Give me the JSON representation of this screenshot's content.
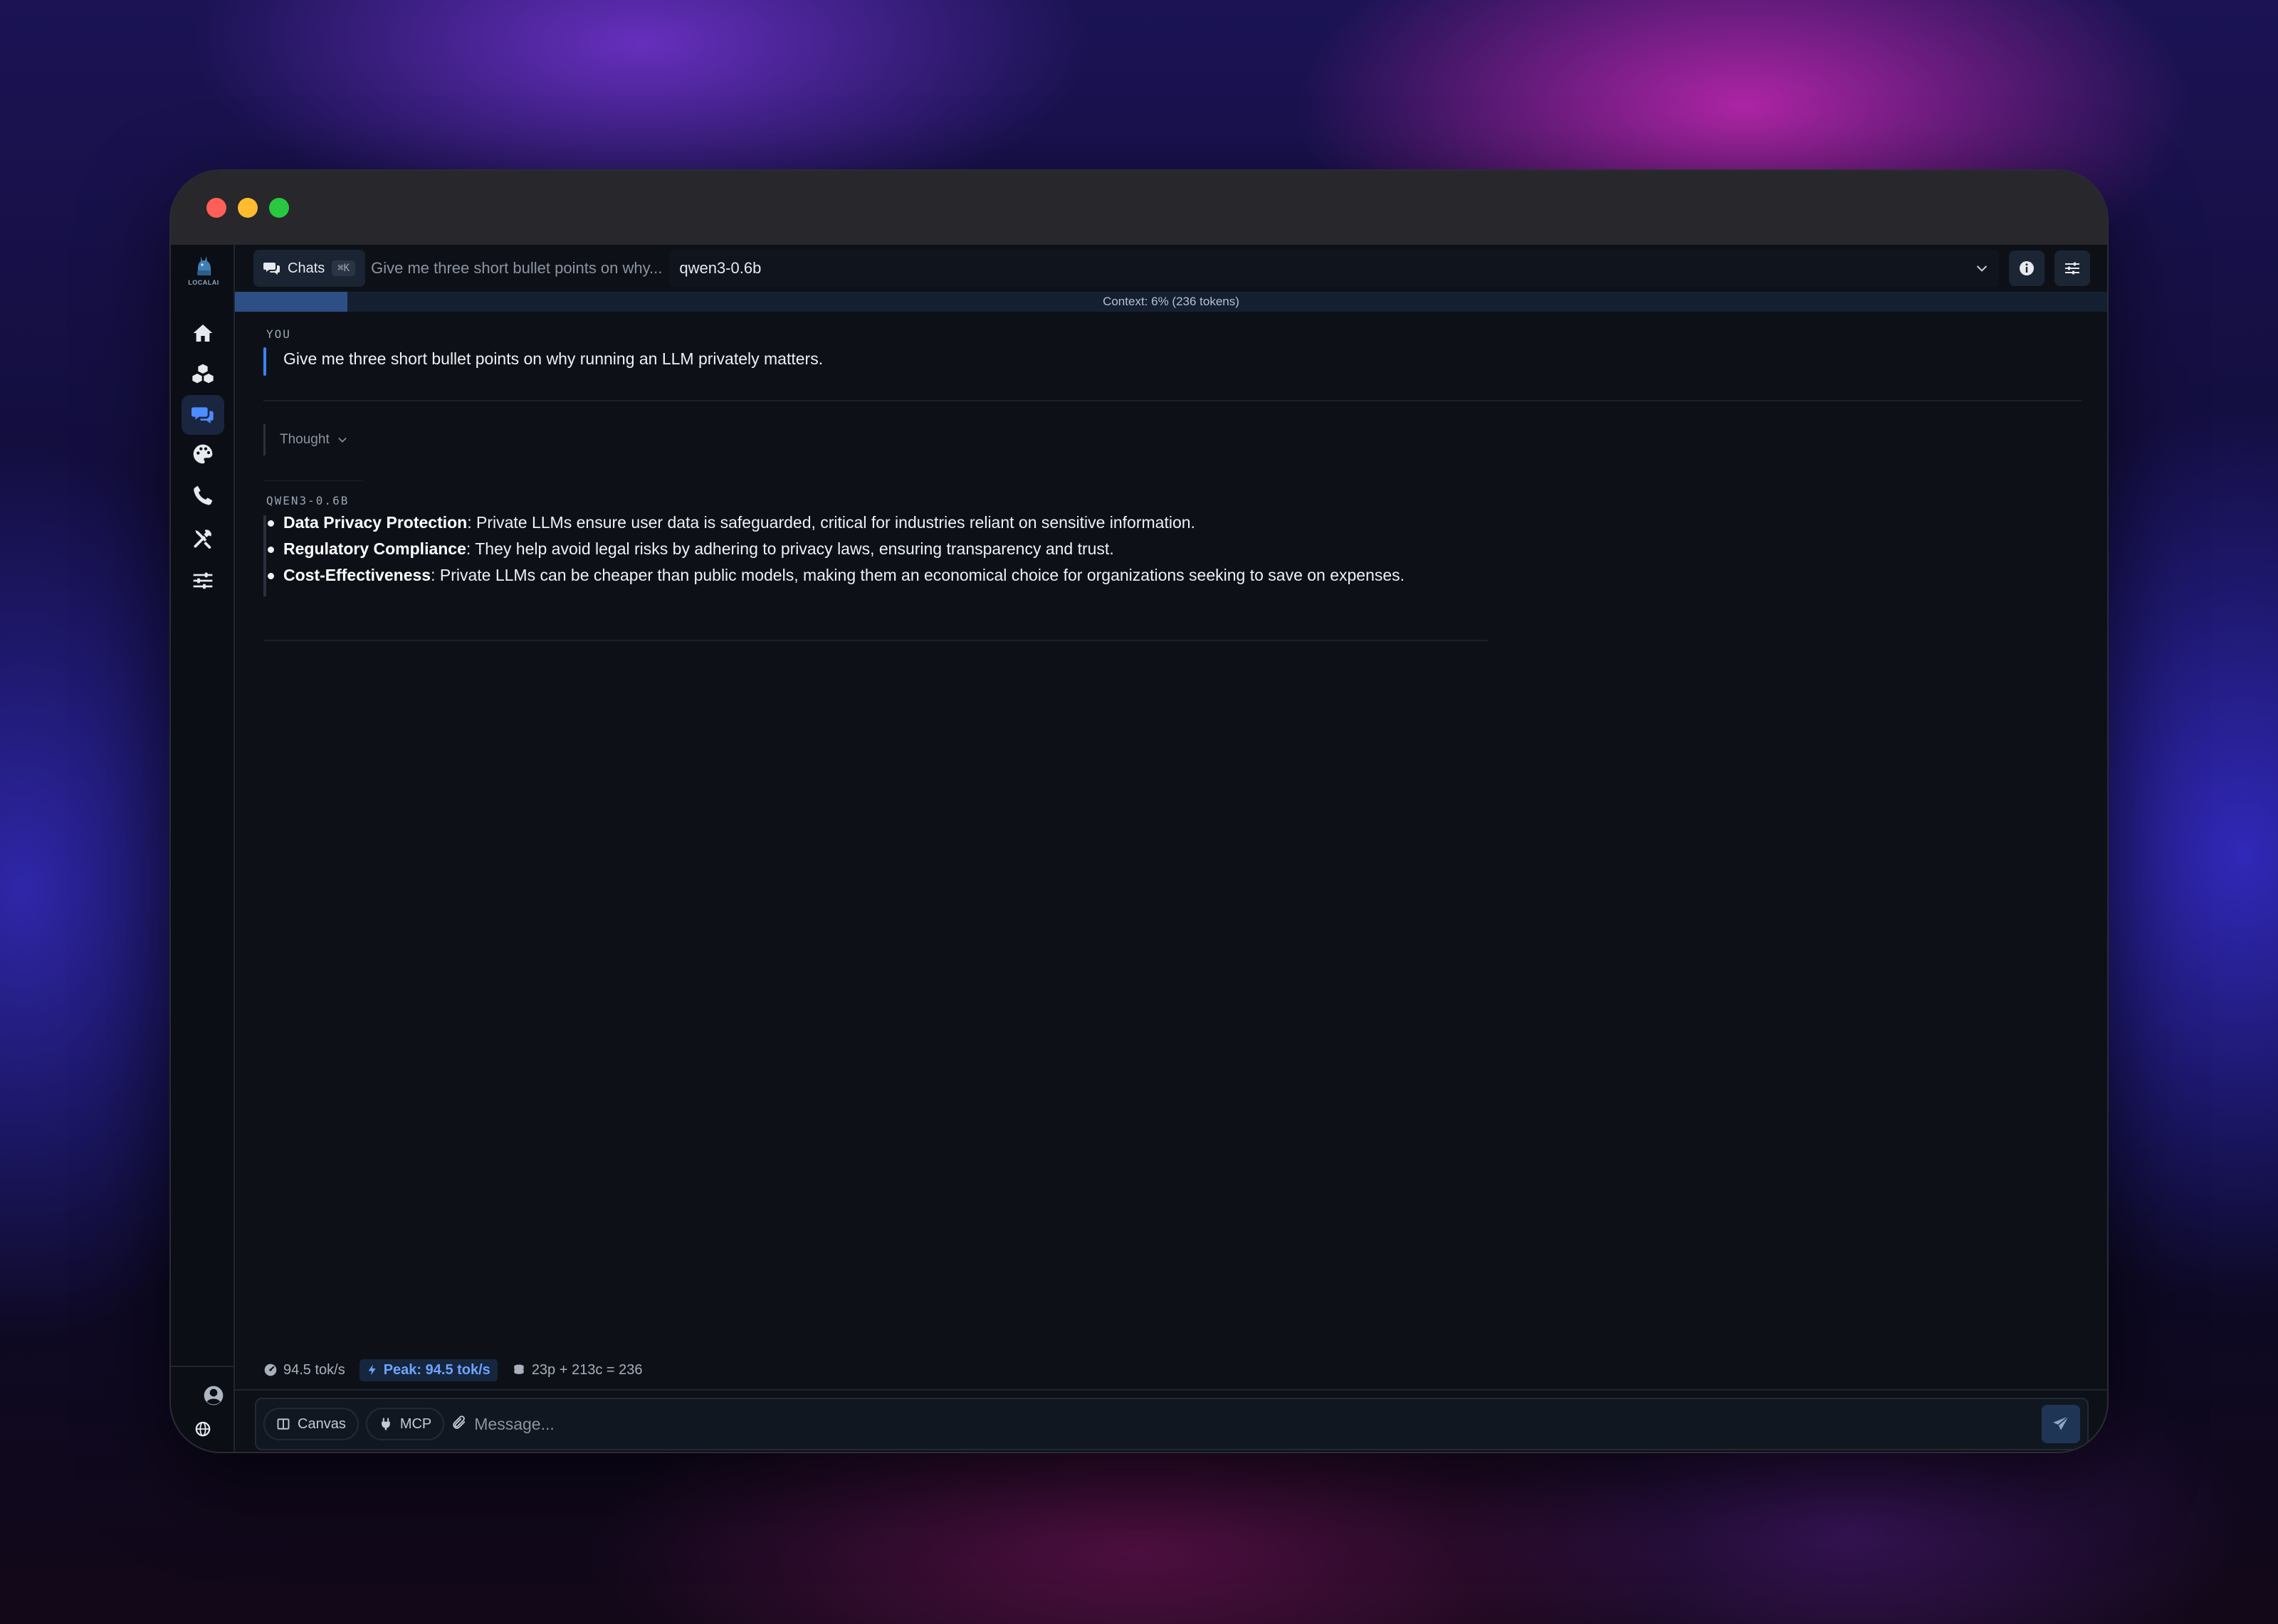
{
  "topbar": {
    "chats_label": "Chats",
    "chats_shortcut": "⌘K",
    "conversation_title": "Give me three short bullet points on why...",
    "model": "qwen3-0.6b"
  },
  "context": {
    "text": "Context: 6% (236 tokens)",
    "percent": 6
  },
  "sidebar": {
    "logo_text": "LOCALAI",
    "items": [
      "home-icon",
      "models-icon",
      "chat-icon",
      "palette-icon",
      "phone-icon",
      "tools-icon",
      "settings-sliders-icon"
    ],
    "active": "chat-icon",
    "bottom": [
      "user-icon",
      "globe-icon",
      "gear-icon",
      "chevron-right-icon"
    ]
  },
  "conversation": {
    "user_label": "YOU",
    "user_message": "Give me three short bullet points on why running an LLM privately matters.",
    "thought_label": "Thought",
    "assistant_label": "QWEN3-0.6B",
    "bullets": [
      {
        "title": "Data Privacy Protection",
        "text": ": Private LLMs ensure user data is safeguarded, critical for industries reliant on sensitive information."
      },
      {
        "title": "Regulatory Compliance",
        "text": ": They help avoid legal risks by adhering to privacy laws, ensuring transparency and trust."
      },
      {
        "title": "Cost-Effectiveness",
        "text": ": Private LLMs can be cheaper than public models, making them an economical choice for organizations seeking to save on expenses."
      }
    ]
  },
  "stats": {
    "speed": "94.5 tok/s",
    "peak": "Peak: 94.5 tok/s",
    "tokens": "23p + 213c = 236"
  },
  "composer": {
    "canvas_label": "Canvas",
    "mcp_label": "MCP",
    "placeholder": "Message..."
  },
  "colors": {
    "accent": "#3b82f6",
    "background": "#0d1117",
    "titlebar": "#27272c"
  }
}
